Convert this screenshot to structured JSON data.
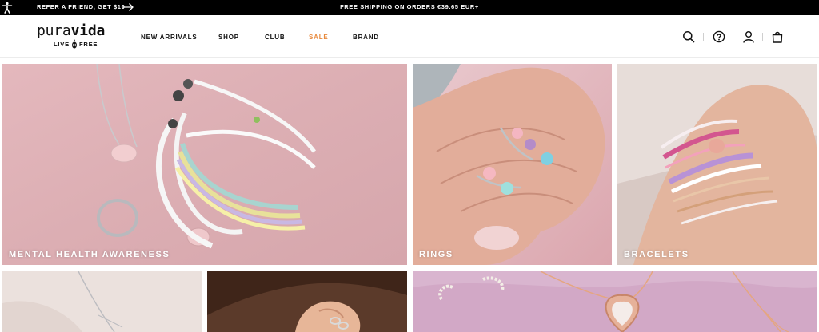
{
  "topbar": {
    "refer_text": "REFER A FRIEND, GET $10",
    "shipping_text": "FREE SHIPPING ON ORDERS €39.65 EUR+",
    "icons": [
      "accessibility-icon",
      "arrow-right-icon"
    ]
  },
  "header": {
    "logo": {
      "wordmark_light": "pura",
      "wordmark_bold": "vida",
      "tagline_left": "LIVE",
      "tagline_right": "FREE"
    },
    "nav": [
      {
        "label": "NEW ARRIVALS"
      },
      {
        "label": "SHOP"
      },
      {
        "label": "CLUB"
      },
      {
        "label": "SALE"
      },
      {
        "label": "BRAND"
      }
    ],
    "icons": [
      "search-icon",
      "help-icon",
      "account-icon",
      "bag-icon"
    ]
  },
  "tiles": [
    {
      "caption": "MENTAL HEALTH AWARENESS"
    },
    {
      "caption": "RINGS"
    },
    {
      "caption": "BRACELETS"
    },
    {
      "caption": ""
    },
    {
      "caption": ""
    },
    {
      "caption": ""
    }
  ],
  "colors": {
    "topbar_bg": "#000000",
    "sale_accent": "#e8893c",
    "caption_text": "#ffffff"
  }
}
